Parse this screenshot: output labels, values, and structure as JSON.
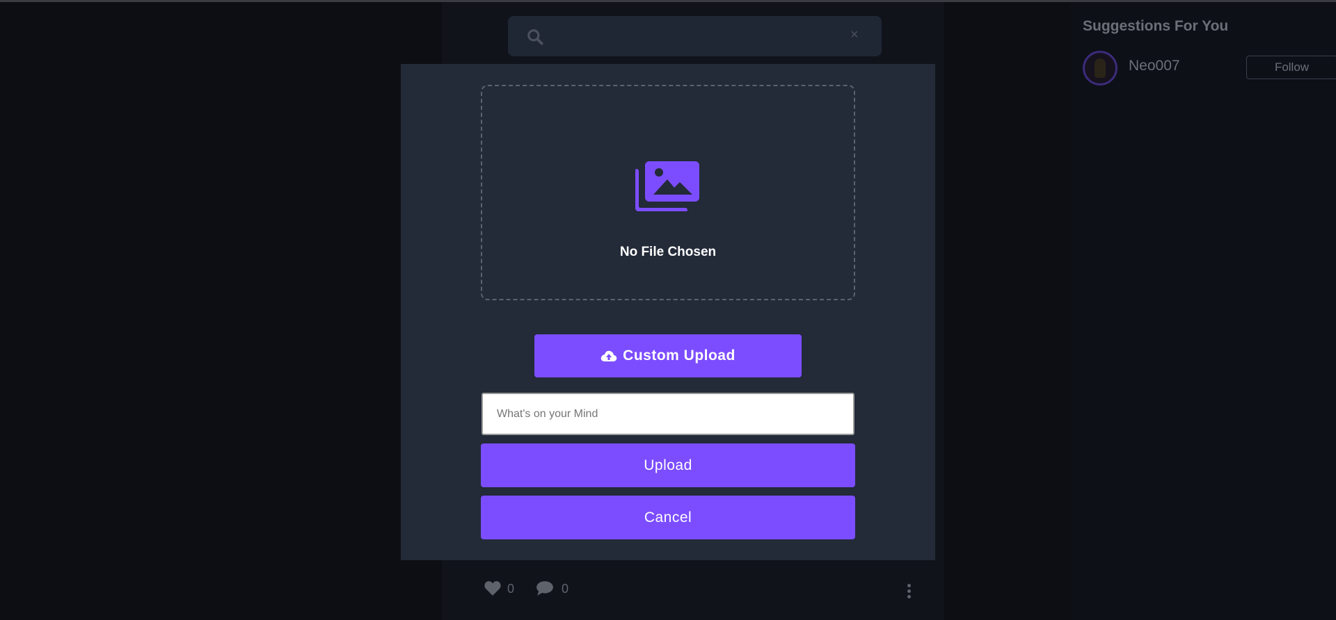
{
  "search": {
    "placeholder": "",
    "clear_symbol": "×"
  },
  "sidebar": {
    "title": "Suggestions For You",
    "suggestions": [
      {
        "username": "Neo007",
        "follow_label": "Follow"
      }
    ]
  },
  "post": {
    "likes": "0",
    "comments": "0"
  },
  "modal": {
    "file_status": "No File Chosen",
    "custom_upload_label": "Custom Upload",
    "caption_placeholder": "What's on your Mind",
    "caption_value": "",
    "upload_label": "Upload",
    "cancel_label": "Cancel"
  },
  "colors": {
    "accent": "#7c4dff",
    "modal_bg": "#232a38",
    "page_bg": "#0c0e13"
  },
  "icons": [
    "search-icon",
    "clear-icon",
    "images-icon",
    "cloud-upload-icon",
    "heart-icon",
    "comment-icon",
    "more-vertical-icon"
  ]
}
